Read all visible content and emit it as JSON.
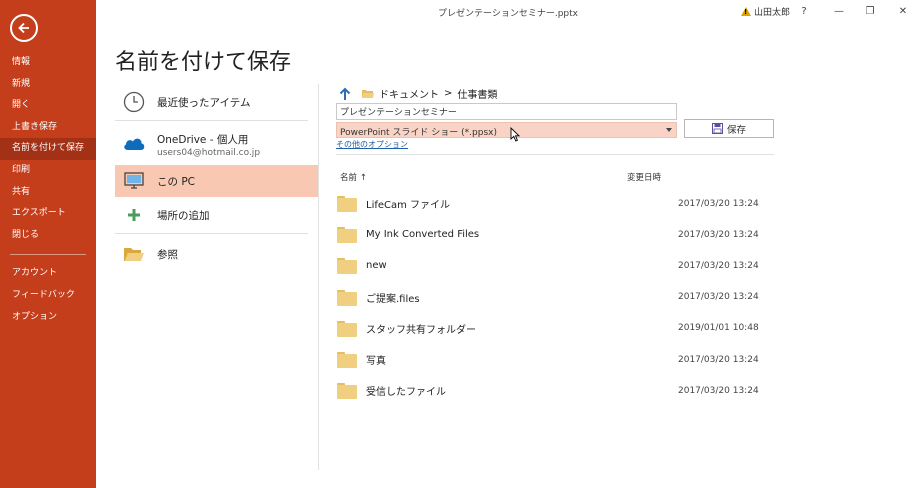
{
  "window": {
    "title": "プレゼンテーションセミナー.pptx",
    "user_name": "山田太郎",
    "help_label": "?",
    "minimize_label": "—",
    "restore_label": "❐",
    "close_label": "✕"
  },
  "nav": {
    "items": [
      {
        "label": "情報"
      },
      {
        "label": "新規"
      },
      {
        "label": "開く"
      },
      {
        "label": "上書き保存"
      },
      {
        "label": "名前を付けて保存"
      },
      {
        "label": "印刷"
      },
      {
        "label": "共有"
      },
      {
        "label": "エクスポート"
      },
      {
        "label": "閉じる"
      }
    ],
    "bottom_items": [
      {
        "label": "アカウント"
      },
      {
        "label": "フィードバック"
      },
      {
        "label": "オプション"
      }
    ],
    "active_index": 4,
    "colors": {
      "background": "#c43e1c",
      "active": "#a33115"
    }
  },
  "page_title": "名前を付けて保存",
  "places": {
    "recent": "最近使ったアイテム",
    "onedrive_name": "OneDrive - 個人用",
    "onedrive_account": "users04@hotmail.co.jp",
    "this_pc": "この PC",
    "add_place": "場所の追加",
    "browse": "参照",
    "selected_color": "#f9c8b2"
  },
  "breadcrumb": {
    "items": [
      "ドキュメント",
      "仕事書類"
    ],
    "separator": ">"
  },
  "save_form": {
    "filename": "プレゼンテーションセミナー",
    "file_type": "PowerPoint スライド ショー (*.ppsx)",
    "more_options": "その他のオプション",
    "save_label": "保存"
  },
  "files": {
    "col_name": "名前 ↑",
    "col_date": "変更日時",
    "rows": [
      {
        "name": "LifeCam ファイル",
        "date": "2017/03/20 13:24"
      },
      {
        "name": "My Ink Converted Files",
        "date": "2017/03/20 13:24"
      },
      {
        "name": "new",
        "date": "2017/03/20 13:24"
      },
      {
        "name": "ご提案.files",
        "date": "2017/03/20 13:24"
      },
      {
        "name": "スタッフ共有フォルダー",
        "date": "2019/01/01 10:48"
      },
      {
        "name": "写真",
        "date": "2017/03/20 13:24"
      },
      {
        "name": "受信したファイル",
        "date": "2017/03/20 13:24"
      }
    ]
  }
}
